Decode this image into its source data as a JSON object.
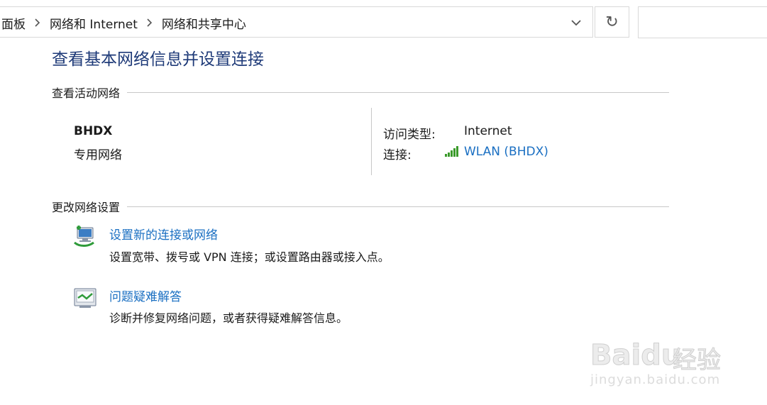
{
  "breadcrumb": [
    "面板",
    "网络和 Internet",
    "网络和共享中心"
  ],
  "search": {
    "placeholder": ""
  },
  "icons": {
    "chevron": "chevron-right-icon",
    "dropdown": "chevron-down-icon",
    "refresh": "refresh-icon",
    "signal": "wifi-signal-icon",
    "setup": "network-setup-icon",
    "troubleshoot": "troubleshoot-icon"
  },
  "refresh_glyph": "↻",
  "page_title": "查看基本网络信息并设置连接",
  "active_networks": {
    "heading": "查看活动网络",
    "network_name": "BHDX",
    "network_category": "专用网络",
    "access_type_label": "访问类型:",
    "access_type_value": "Internet",
    "connection_label": "连接:",
    "connection_value": "WLAN (BHDX)"
  },
  "change_settings": {
    "heading": "更改网络设置",
    "tasks": [
      {
        "link": "设置新的连接或网络",
        "description": "设置宽带、拨号或 VPN 连接；或设置路由器或接入点。"
      },
      {
        "link": "问题疑难解答",
        "description": "诊断并修复网络问题，或者获得疑难解答信息。"
      }
    ]
  },
  "watermark": {
    "brand": "Baidu",
    "cn": "经验",
    "url": "jingyan.baidu.com"
  },
  "colors": {
    "title": "#1e3a78",
    "link": "#1a6fc2",
    "signal": "#3a9a2a"
  }
}
